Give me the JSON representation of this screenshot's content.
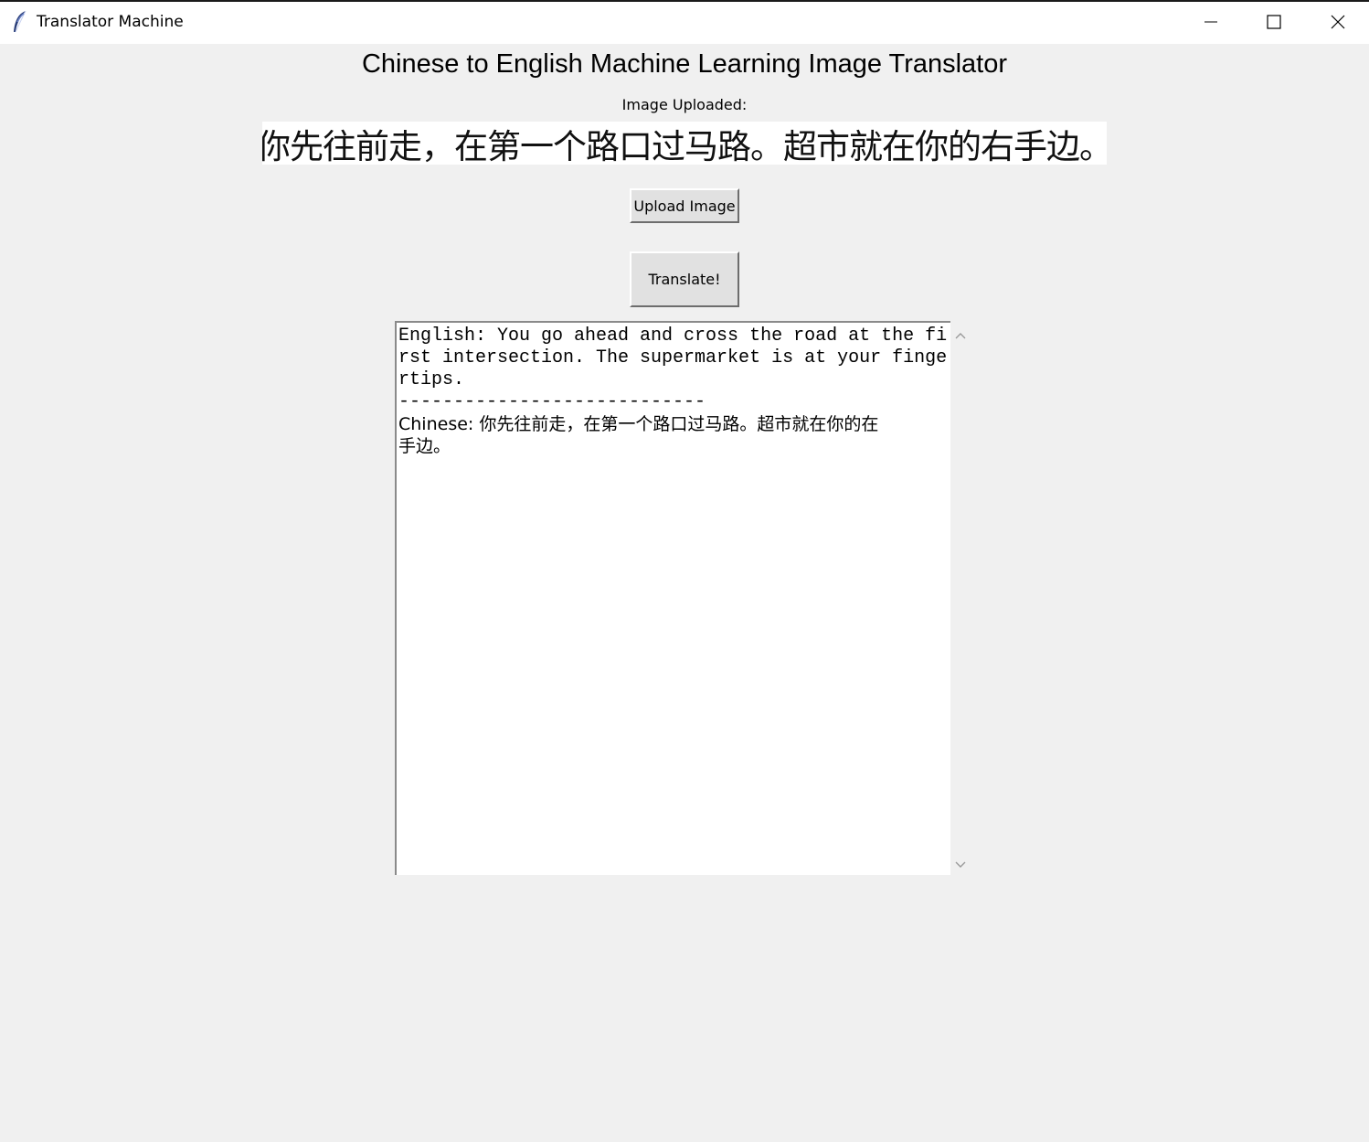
{
  "window": {
    "title": "Translator Machine",
    "icon": "feather-icon",
    "controls": [
      "minimize-icon",
      "maximize-icon",
      "close-icon"
    ]
  },
  "main": {
    "heading": "Chinese to English Machine Learning Image Translator",
    "image_label": "Image Uploaded:",
    "uploaded_image_text": "你先往前走，在第一个路口过马路。超市就在你的右手边。",
    "upload_button_label": "Upload Image",
    "translate_button_label": "Translate!"
  },
  "output": {
    "lines": [
      "English: You go ahead and cross the road at the fi",
      "rst intersection. The supermarket is at your finge",
      "rtips.",
      "----------------------------",
      "Chinese: 你先往前走，在第一个路口过马路。超市就在你的在",
      "手边。"
    ]
  },
  "colors": {
    "window_background": "#f0f0f0",
    "titlebar_background": "#ffffff",
    "textbox_background": "#ffffff",
    "button_face": "#e1e1e1"
  }
}
